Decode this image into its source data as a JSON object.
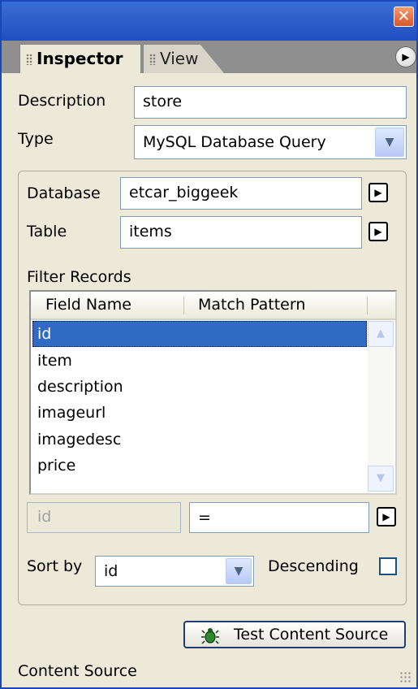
{
  "window": {
    "close_glyph": "✕",
    "options_glyph": "▶"
  },
  "tabs": [
    {
      "label": "Inspector",
      "active": true
    },
    {
      "label": "View",
      "active": false
    }
  ],
  "form": {
    "description_label": "Description",
    "description_value": "store",
    "type_label": "Type",
    "type_value": "MySQL Database Query",
    "database_label": "Database",
    "database_value": "etcar_biggeek",
    "table_label": "Table",
    "table_value": "items"
  },
  "filter": {
    "section_label": "Filter Records",
    "columns": [
      "Field Name",
      "Match Pattern"
    ],
    "rows": [
      "id",
      "item",
      "description",
      "imageurl",
      "imagedesc",
      "price"
    ],
    "selected_row": "id",
    "field_value": "id",
    "operator_value": "="
  },
  "sort": {
    "label": "Sort by",
    "value": "id",
    "descending_label": "Descending",
    "descending_checked": false
  },
  "test_button_label": "Test Content Source",
  "status_text": "Content Source",
  "colors": {
    "title_bar": "#2756c8",
    "selection": "#316ac5",
    "panel": "#ece9d8"
  }
}
